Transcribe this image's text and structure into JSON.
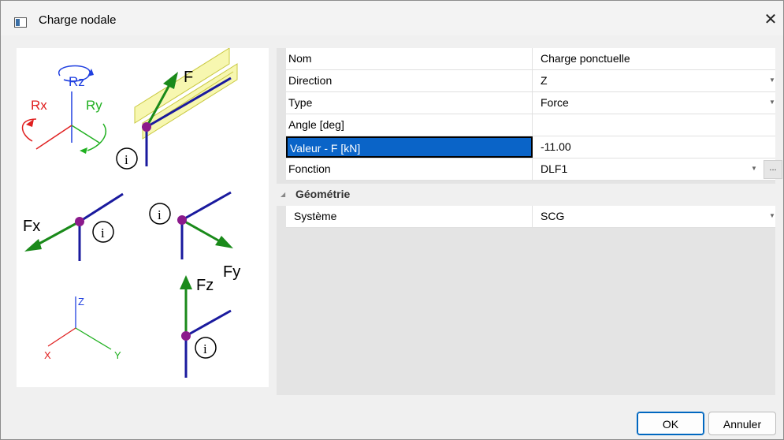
{
  "window": {
    "title": "Charge nodale",
    "close_glyph": "✕"
  },
  "picture": {
    "labels": {
      "rz": "Rz",
      "rx": "Rx",
      "ry": "Ry",
      "f": "F",
      "fx": "Fx",
      "fy": "Fy",
      "fz": "Fz",
      "axis_z": "Z",
      "axis_x": "X",
      "axis_y": "Y",
      "info": "i"
    }
  },
  "properties": {
    "rows": [
      {
        "label": "Nom",
        "value": "Charge ponctuelle"
      },
      {
        "label": "Direction",
        "value": "Z",
        "dropdown": true
      },
      {
        "label": "Type",
        "value": "Force",
        "dropdown": true
      },
      {
        "label": "Angle [deg]",
        "value": ""
      },
      {
        "label": "Valeur - F [kN]",
        "value": "-11.00",
        "selected": true
      },
      {
        "label": "Fonction",
        "value": "DLF1",
        "dropdown": true,
        "ellipsis": "..."
      }
    ],
    "group": {
      "name": "Géométrie",
      "rows": [
        {
          "label": "Système",
          "value": "SCG",
          "dropdown": true
        }
      ]
    }
  },
  "buttons": {
    "ok": "OK",
    "cancel": "Annuler"
  },
  "colors": {
    "selection": "#0a64c8",
    "beam": "#1a1a9e",
    "force_arrow": "#1a8a1a",
    "node": "#8b1a8b",
    "rx": "#e02020",
    "ry": "#20b020",
    "rz": "#2040e0",
    "ibeam": "#e8e870"
  }
}
